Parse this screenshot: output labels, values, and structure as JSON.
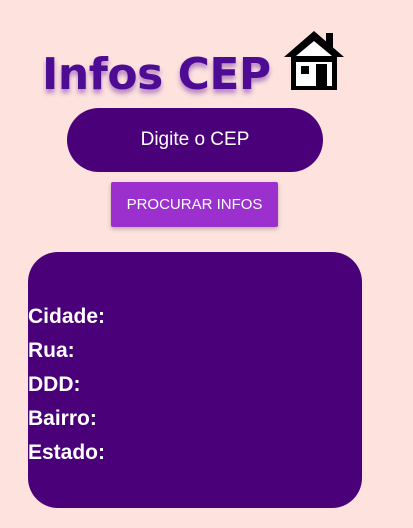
{
  "header": {
    "title": "Infos CEP",
    "icon": "house-icon"
  },
  "search": {
    "placeholder": "Digite o CEP",
    "value": ""
  },
  "actions": {
    "search_label": "PROCURAR INFOS"
  },
  "result": {
    "fields": [
      "Cidade:",
      "Rua:",
      "DDD:",
      "Bairro:",
      "Estado:"
    ]
  },
  "colors": {
    "background": "#fde2de",
    "primary": "#4a0079",
    "button": "#9b30cf",
    "title": "#4d0c93"
  }
}
